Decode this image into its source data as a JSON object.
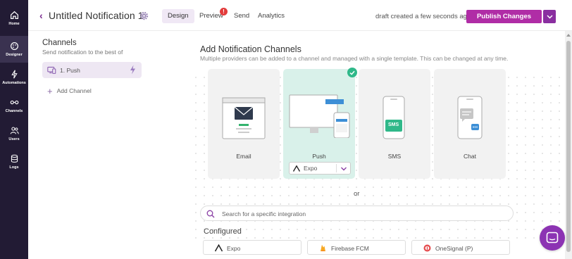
{
  "nav": {
    "items": [
      {
        "label": "Home",
        "icon": "home-icon"
      },
      {
        "label": "Designer",
        "icon": "designer-icon",
        "active": true
      },
      {
        "label": "Automations",
        "icon": "automation-bolt-icon"
      },
      {
        "label": "Channels",
        "icon": "channels-icon"
      },
      {
        "label": "Users",
        "icon": "users-icon"
      },
      {
        "label": "Logs",
        "icon": "logs-icon"
      }
    ]
  },
  "header": {
    "title": "Untitled Notification 1",
    "tabs": [
      {
        "label": "Design",
        "active": true
      },
      {
        "label": "Preview"
      },
      {
        "label": "Send"
      },
      {
        "label": "Analytics"
      }
    ],
    "preview_badge": "!",
    "draft_status": "draft created a few seconds ago",
    "publish_label": "Publish Changes"
  },
  "sidebar": {
    "title": "Channels",
    "subtitle": "Send notification to the best of",
    "channels": [
      {
        "label": "1.  Push"
      }
    ],
    "add_label": "Add Channel"
  },
  "main": {
    "title": "Add Notification Channels",
    "subtitle": "Multiple providers can be added to a channel and managed with a single template. This can be changed at any time.",
    "cards": [
      {
        "label": "Email",
        "selected": false
      },
      {
        "label": "Push",
        "selected": true
      },
      {
        "label": "SMS",
        "selected": false
      },
      {
        "label": "Chat",
        "selected": false
      }
    ],
    "push_provider": "Expo",
    "sms_text": "SMS",
    "or_label": "or",
    "search_placeholder": "Search for a specific integration",
    "configured_title": "Configured",
    "integrations": [
      {
        "label": "Expo"
      },
      {
        "label": "Firebase FCM"
      },
      {
        "label": "OneSignal (P)"
      }
    ]
  },
  "colors": {
    "brand": "#b02da6",
    "rail": "#221b34",
    "selected_card": "#d9f1ea",
    "check": "#2fb889"
  }
}
